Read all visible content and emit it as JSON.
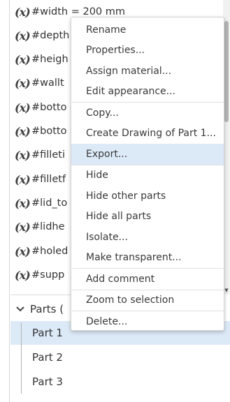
{
  "variables": [
    {
      "icon": "(x)",
      "name": "#width = 200 mm"
    },
    {
      "icon": "(x)",
      "name": "#depth"
    },
    {
      "icon": "(x)",
      "name": "#heigh"
    },
    {
      "icon": "(x)",
      "name": "#wallt"
    },
    {
      "icon": "(x)",
      "name": "#botto"
    },
    {
      "icon": "(x)",
      "name": "#botto"
    },
    {
      "icon": "(x)",
      "name": "#filleti"
    },
    {
      "icon": "(x)",
      "name": "#filletf"
    },
    {
      "icon": "(x)",
      "name": "#lid_to"
    },
    {
      "icon": "(x)",
      "name": "#lidhe"
    },
    {
      "icon": "(x)",
      "name": "#holed"
    },
    {
      "icon": "(x)",
      "name": "#supp"
    }
  ],
  "parts": {
    "header_label": "Parts (",
    "items": [
      "Part 1",
      "Part 2",
      "Part 3"
    ],
    "selected": "Part 1"
  },
  "context_menu": {
    "items": [
      "Rename",
      "Properties...",
      "Assign material...",
      "Edit appearance...",
      "Copy...",
      "Create Drawing of Part 1...",
      "Export...",
      "Hide",
      "Hide other parts",
      "Hide all parts",
      "Isolate...",
      "Make transparent...",
      "Add comment",
      "Zoom to selection",
      "Delete..."
    ],
    "highlighted": "Export..."
  },
  "colors": {
    "selection": "#dce9f7",
    "border": "#d3d3d3",
    "text": "#333333"
  }
}
